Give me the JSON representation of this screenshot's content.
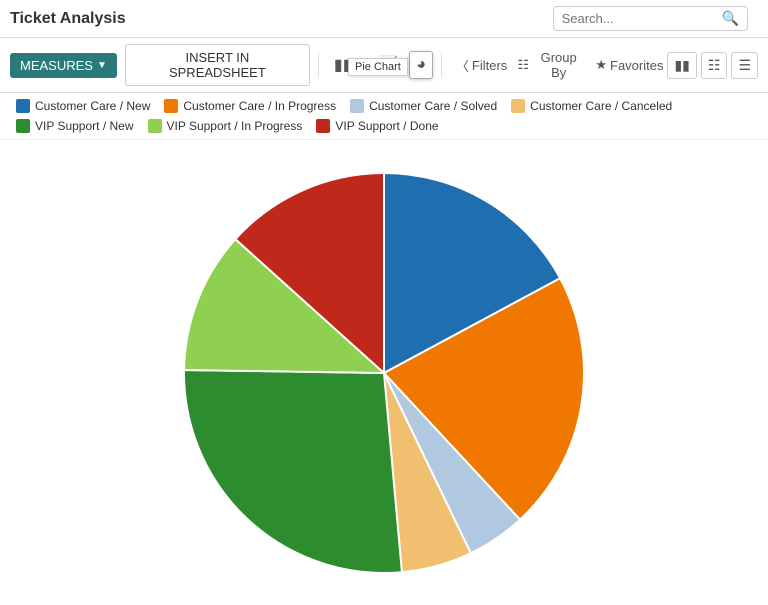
{
  "header": {
    "title": "Ticket Analysis",
    "search_placeholder": "Search..."
  },
  "toolbar": {
    "measures_label": "MEASURES",
    "insert_label": "INSERT IN SPREADSHEET",
    "filters_label": "Filters",
    "groupby_label": "Group By",
    "favorites_label": "Favorites",
    "pie_chart_tooltip": "Pie Chart"
  },
  "legend": [
    {
      "id": "cc-new",
      "label": "Customer Care / New",
      "color": "#1f6fb0"
    },
    {
      "id": "cc-inprogress",
      "label": "Customer Care / In Progress",
      "color": "#f07800"
    },
    {
      "id": "cc-solved",
      "label": "Customer Care / Solved",
      "color": "#b0c8e0"
    },
    {
      "id": "cc-canceled",
      "label": "Customer Care / Canceled",
      "color": "#f0c070"
    },
    {
      "id": "vip-new",
      "label": "VIP Support / New",
      "color": "#2d8c2d"
    },
    {
      "id": "vip-inprogress",
      "label": "VIP Support / In Progress",
      "color": "#90d050"
    },
    {
      "id": "vip-done",
      "label": "VIP Support / Done",
      "color": "#c0281c"
    }
  ],
  "pie": {
    "segments": [
      {
        "label": "Customer Care / New",
        "value": 18,
        "color": "#1f6fb0"
      },
      {
        "label": "Customer Care / In Progress",
        "value": 22,
        "color": "#f07800"
      },
      {
        "label": "Customer Care / Solved",
        "value": 5,
        "color": "#b0c8e0"
      },
      {
        "label": "Customer Care / Canceled",
        "value": 6,
        "color": "#f0c070"
      },
      {
        "label": "VIP Support / New",
        "value": 28,
        "color": "#2d8c2d"
      },
      {
        "label": "VIP Support / In Progress",
        "value": 12,
        "color": "#90d050"
      },
      {
        "label": "VIP Support / Done",
        "value": 14,
        "color": "#c0281c"
      }
    ]
  }
}
